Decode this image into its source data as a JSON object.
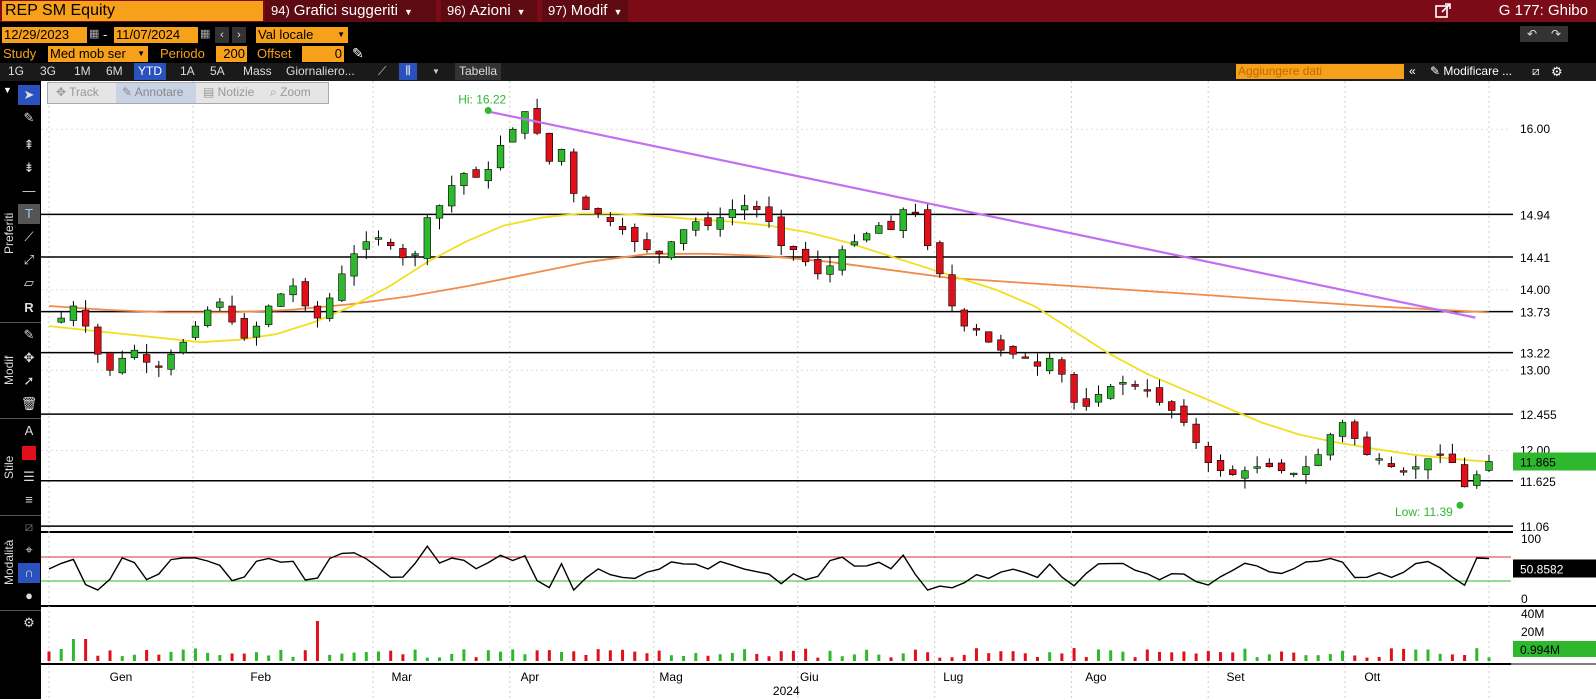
{
  "header": {
    "ticker": "REP SM Equity",
    "menus": [
      {
        "num": "94)",
        "label": "Grafici suggeriti"
      },
      {
        "num": "96)",
        "label": "Azioni"
      },
      {
        "num": "97)",
        "label": "Modif"
      }
    ],
    "right_title": "G 177: Ghibo"
  },
  "controls": {
    "date_start": "12/29/2023",
    "date_sep": "-",
    "date_end": "11/07/2024",
    "currency": "Val locale",
    "study_label": "Study",
    "study_value": "Med mob ser",
    "period_label": "Periodo",
    "period_value": "200",
    "offset_label": "Offset",
    "offset_value": "0"
  },
  "tabs": [
    "1G",
    "3G",
    "1M",
    "6M",
    "YTD",
    "1A",
    "5A",
    "Mass",
    "Giornaliero..."
  ],
  "active_tab": "YTD",
  "table_label": "Tabella",
  "add_data_placeholder": "Aggiungere dati",
  "modify_label": "Modificare ...",
  "chart_toolbar": [
    "Track",
    "Annotare",
    "Notizie",
    "Zoom"
  ],
  "side_labels": {
    "favorites": "Preferiti",
    "modify": "Modif",
    "style": "Stile",
    "mode": "Modalità"
  },
  "colors": {
    "title_bar": "#7b0c17",
    "accent": "#f7a11a",
    "up": "#2eb82e",
    "down": "#e0101a",
    "ma_short": "#f0e020",
    "ma_long": "#f08c4a",
    "trendline": "#c070f0"
  },
  "chart_data": {
    "type": "candlestick",
    "x_axis_labels": [
      "Gen",
      "Feb",
      "Mar",
      "Apr",
      "Mag",
      "Giu",
      "Lug",
      "Ago",
      "Set",
      "Ott"
    ],
    "x_axis_year": "2024",
    "price_axis_ticks": [
      16.0,
      14.0,
      13.0,
      12.0
    ],
    "ylim": [
      11.0,
      16.6
    ],
    "hi_label": "Hi: 16.22",
    "low_label": "Low: 11.39",
    "horizontal_levels": [
      14.94,
      14.41,
      13.73,
      13.22,
      12.455,
      11.625,
      11.06
    ],
    "level_labels": [
      "14.94",
      "14.41",
      "13.73",
      "13.22",
      "12.455",
      "11.625",
      "11.06"
    ],
    "last_price": "11.865",
    "close_path": [
      13.6,
      13.65,
      13.8,
      13.55,
      13.2,
      13.0,
      13.15,
      13.25,
      13.1,
      13.05,
      13.2,
      13.35,
      13.55,
      13.75,
      13.85,
      13.6,
      13.4,
      13.55,
      13.8,
      13.95,
      14.05,
      13.8,
      13.65,
      13.9,
      14.2,
      14.45,
      14.6,
      14.65,
      14.55,
      14.4,
      14.45,
      14.9,
      15.05,
      15.3,
      15.45,
      15.4,
      15.5,
      15.8,
      16.0,
      16.22,
      15.95,
      15.6,
      15.75,
      15.2,
      15.0,
      14.95,
      14.85,
      14.75,
      14.6,
      14.5,
      14.45,
      14.6,
      14.75,
      14.85,
      14.8,
      14.9,
      15.0,
      15.05,
      15.0,
      14.85,
      14.55,
      14.5,
      14.35,
      14.2,
      14.3,
      14.5,
      14.6,
      14.7,
      14.8,
      14.75,
      15.0,
      14.95,
      14.55,
      14.2,
      13.8,
      13.55,
      13.5,
      13.35,
      13.25,
      13.2,
      13.15,
      13.05,
      13.15,
      12.95,
      12.6,
      12.55,
      12.7,
      12.8,
      12.85,
      12.8,
      12.75,
      12.6,
      12.5,
      12.35,
      12.1,
      11.85,
      11.75,
      11.7,
      11.75,
      11.8,
      11.8,
      11.75,
      11.72,
      11.8,
      11.95,
      12.2,
      12.35,
      12.15,
      11.95,
      11.9,
      11.8,
      11.75,
      11.8,
      11.9,
      11.95,
      11.85,
      11.55,
      11.7,
      11.865
    ],
    "ma50": [
      13.55,
      13.5,
      13.45,
      13.4,
      13.35,
      13.38,
      13.45,
      13.6,
      13.8,
      14.05,
      14.35,
      14.6,
      14.8,
      14.9,
      14.95,
      14.95,
      14.92,
      14.88,
      14.85,
      14.8,
      14.72,
      14.6,
      14.45,
      14.3,
      14.15,
      14.0,
      13.8,
      13.5,
      13.2,
      12.95,
      12.75,
      12.55,
      12.35,
      12.2,
      12.1,
      12.02,
      11.95,
      11.9,
      11.86
    ],
    "ma200": [
      13.8,
      13.75,
      13.72,
      13.72,
      13.75,
      13.82,
      13.92,
      14.05,
      14.2,
      14.35,
      14.45,
      14.45,
      14.42,
      14.35,
      14.25,
      14.15,
      14.1,
      14.05,
      14.0,
      13.95,
      13.9,
      13.85,
      13.8,
      13.76,
      13.72
    ],
    "trendline": [
      [
        16.22,
        0.305
      ],
      [
        13.73,
        0.985
      ]
    ],
    "rsi": {
      "ticks": [
        "100",
        "50.8582",
        "0"
      ],
      "value": 50.8582,
      "upper": 70,
      "lower": 30
    },
    "volume": {
      "ticks": [
        "40M",
        "20M"
      ],
      "last": "0.994M"
    }
  }
}
